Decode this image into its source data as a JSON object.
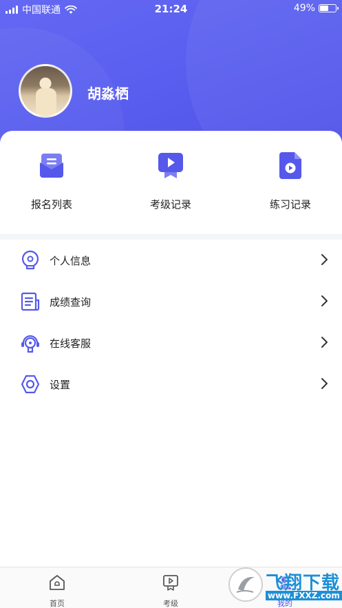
{
  "status_bar": {
    "carrier": "中国联通",
    "time": "21:24",
    "battery": "49%",
    "battery_level": 0.49
  },
  "profile": {
    "name": "胡淼栖"
  },
  "quick_actions": [
    {
      "label": "报名列表",
      "icon": "registration-list-icon"
    },
    {
      "label": "考级记录",
      "icon": "exam-record-icon"
    },
    {
      "label": "练习记录",
      "icon": "practice-record-icon"
    }
  ],
  "menu": [
    {
      "label": "个人信息",
      "icon": "personal-info-icon"
    },
    {
      "label": "成绩查询",
      "icon": "score-query-icon"
    },
    {
      "label": "在线客服",
      "icon": "customer-service-icon"
    },
    {
      "label": "设置",
      "icon": "settings-icon"
    }
  ],
  "tabs": [
    {
      "label": "首页",
      "icon": "home-icon"
    },
    {
      "label": "考级",
      "icon": "exam-icon"
    },
    {
      "label": "我的",
      "icon": "profile-icon",
      "active": true
    }
  ],
  "watermark": {
    "text": "飞翔下载",
    "url": "www.FXXZ.com"
  },
  "colors": {
    "accent": "#4f52e6",
    "hero_start": "#6468f2",
    "hero_end": "#4f52e6"
  }
}
